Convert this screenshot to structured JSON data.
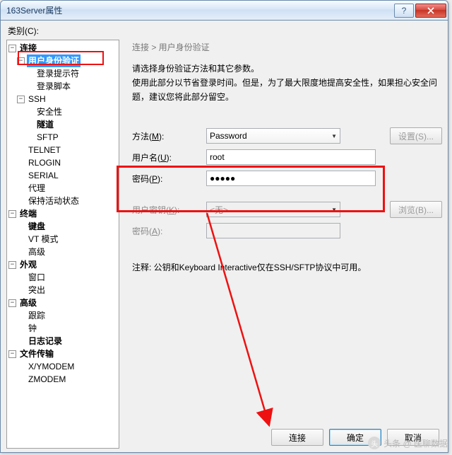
{
  "window": {
    "title": "163Server属性"
  },
  "category_label": "类别(C):",
  "tree": {
    "n_connection": "连接",
    "n_auth": "用户身份验证",
    "n_login_prompt": "登录提示符",
    "n_login_script": "登录脚本",
    "n_ssh": "SSH",
    "n_security": "安全性",
    "n_tunnel": "隧道",
    "n_sftp": "SFTP",
    "n_telnet": "TELNET",
    "n_rlogin": "RLOGIN",
    "n_serial": "SERIAL",
    "n_proxy": "代理",
    "n_keep": "保持活动状态",
    "n_terminal": "终端",
    "n_keyboard": "键盘",
    "n_vtmode": "VT 模式",
    "n_advanced": "高级",
    "n_appearance": "外观",
    "n_window": "窗口",
    "n_highlight": "突出",
    "n_adv": "高级",
    "n_trace": "跟踪",
    "n_bell": "钟",
    "n_log": "日志记录",
    "n_filetrans": "文件传输",
    "n_xymodem": "X/YMODEM",
    "n_zmodem": "ZMODEM"
  },
  "breadcrumb": "连接 > 用户身份验证",
  "desc_line1": "请选择身份验证方法和其它参数。",
  "desc_line2": "使用此部分以节省登录时间。但是，为了最大限度地提高安全性，如果担心安全问题，建议您将此部分留空。",
  "labels": {
    "method": "方法(",
    "method_u": "M",
    "close1": "):",
    "user": "用户名(",
    "user_u": "U",
    "pass": "密码(",
    "pass_u": "P",
    "userkey": "用户密钥(",
    "userkey_u": "K",
    "passphrase": "密码(",
    "passphrase_u": "A"
  },
  "values": {
    "method": "Password",
    "username": "root",
    "password": "●●●●●",
    "userkey": "<无>"
  },
  "buttons": {
    "settings": "设置(S)...",
    "browse": "浏览(B)...",
    "connect": "连接",
    "ok": "确定",
    "cancel": "取消"
  },
  "note": "注释:  公钥和Keyboard Interactive仅在SSH/SFTP协议中可用。",
  "watermark": "头条 @ 医聊数据"
}
